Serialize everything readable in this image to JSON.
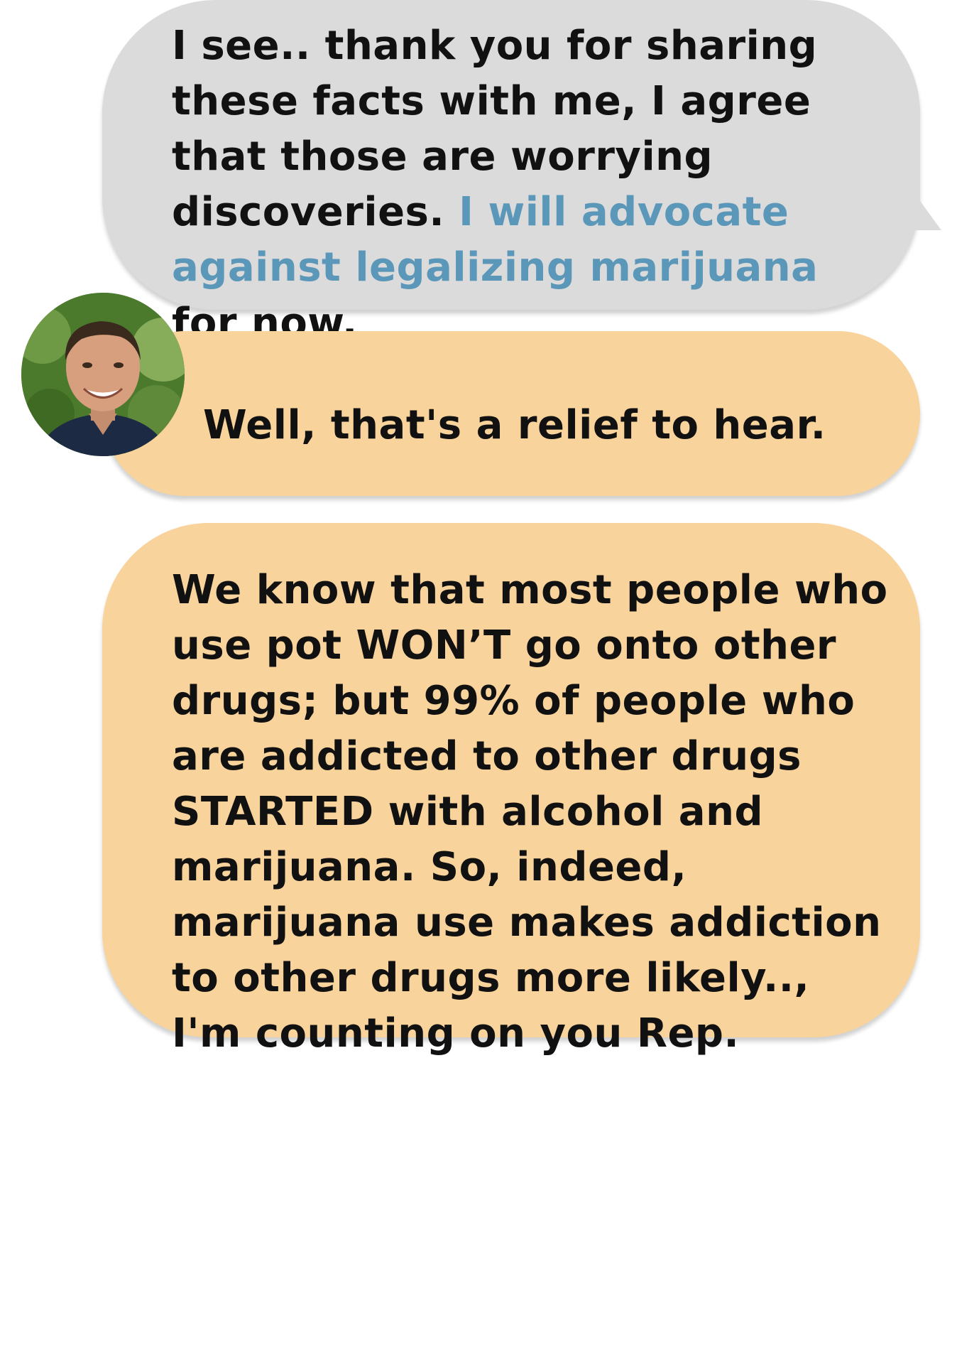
{
  "messages": [
    {
      "sender": "user",
      "text_before": "I see.. thank you for sharing these facts with me, I agree that those are worrying discoveries. ",
      "highlight": "I will advocate against legalizing marijuana",
      "text_after": " for now."
    },
    {
      "sender": "contact",
      "text": "Well, that's a relief to hear."
    },
    {
      "sender": "contact",
      "text": "We know that most people who use pot WON’T go onto other drugs; but 99% of people who are addicted to other drugs STARTED with alcohol and marijuana. So, indeed, marijuana use makes addiction to other drugs more likely.., I'm counting on you Rep."
    }
  ],
  "colors": {
    "user_bubble": "#dbdbdb",
    "contact_bubble": "#f8d39b",
    "highlight_text": "#5b97b8",
    "text": "#111111"
  },
  "icons": {
    "contact_avatar": "avatar"
  }
}
